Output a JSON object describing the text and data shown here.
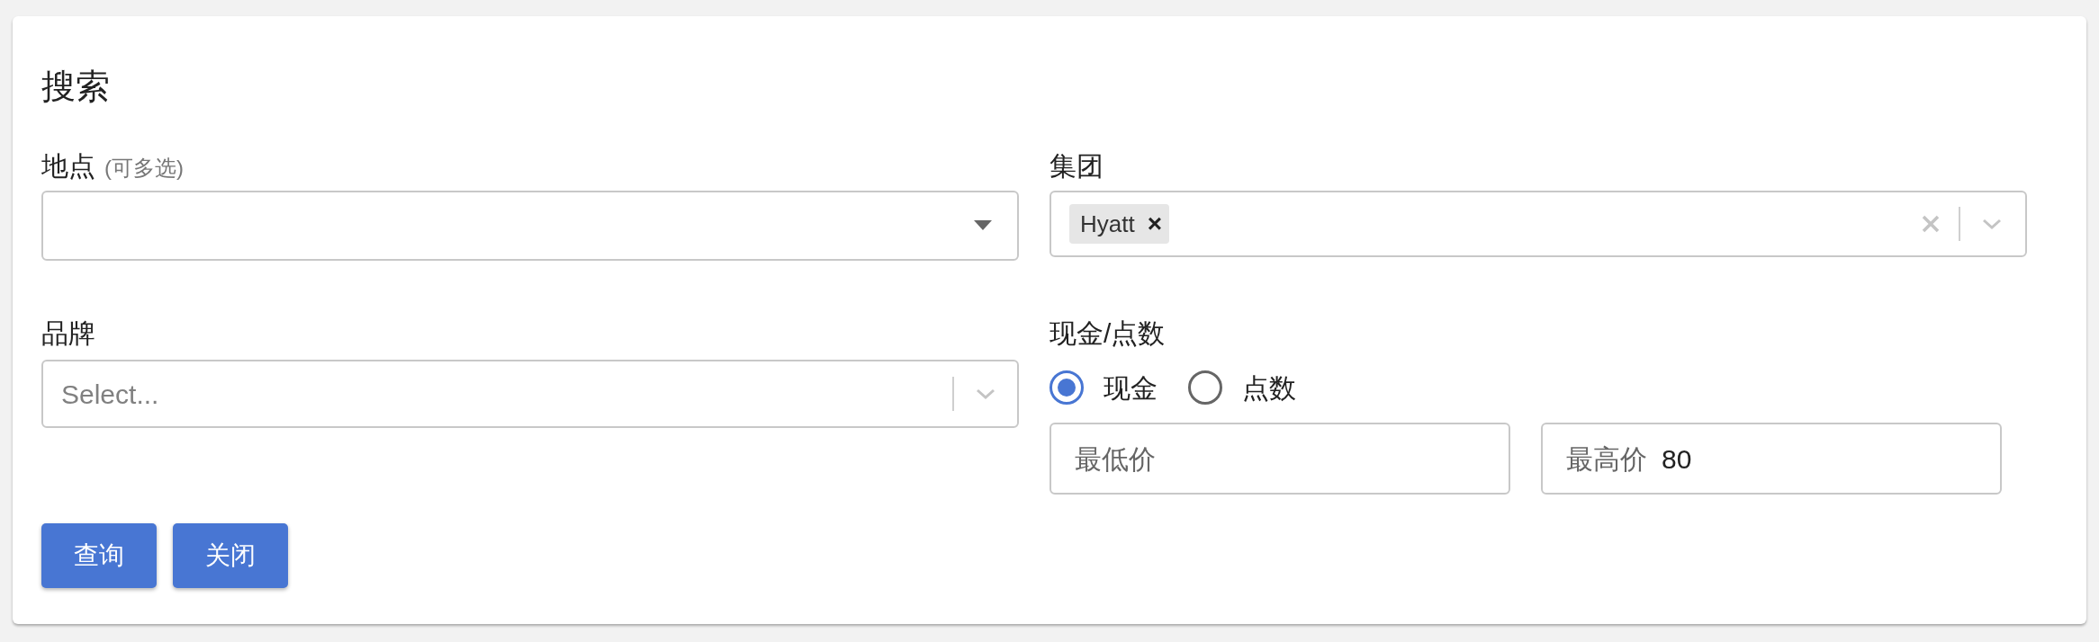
{
  "title": "搜索",
  "location": {
    "label": "地点",
    "hint": "(可多选)"
  },
  "group": {
    "label": "集团",
    "tags": [
      {
        "label": "Hyatt",
        "remove": "×"
      }
    ]
  },
  "brand": {
    "label": "品牌",
    "placeholder": "Select..."
  },
  "payment": {
    "label": "现金/点数",
    "options": [
      {
        "label": "现金",
        "selected": true
      },
      {
        "label": "点数",
        "selected": false
      }
    ]
  },
  "price_fields": [
    {
      "prefix": "最低价"
    },
    {
      "prefix": "最高价",
      "value": "80"
    }
  ],
  "buttons": [
    "查询",
    "关闭"
  ]
}
